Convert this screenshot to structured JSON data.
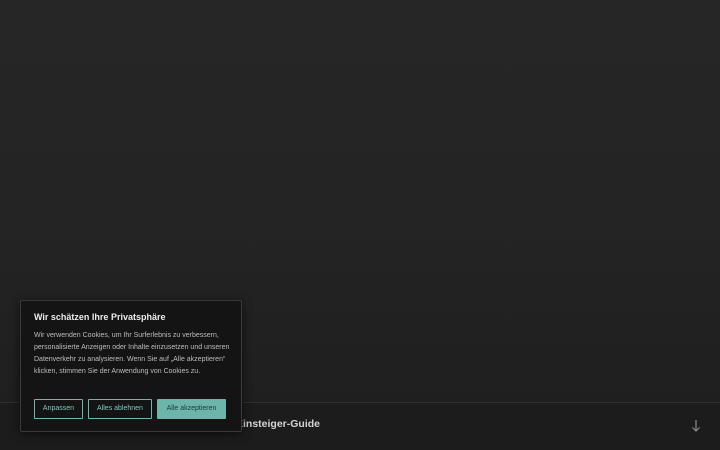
{
  "nav": {
    "title": "Einsteiger-Guide"
  },
  "cookie_banner": {
    "title": "Wir schätzen Ihre Privatsphäre",
    "text": "Wir verwenden Cookies, um Ihr Surferlebnis zu verbessern, personalisierte Anzeigen oder Inhalte einzusetzen und unseren Datenverkehr zu analysieren. Wenn Sie auf „Alle akzeptieren“ klicken, stimmen Sie der Anwendung von Cookies zu.",
    "buttons": {
      "customize": "Anpassen",
      "reject": "Alles ablehnen",
      "accept": "Alle akzeptieren"
    }
  },
  "icons": {
    "scroll_down": "arrow-down-icon"
  },
  "colors": {
    "accent": "#6bb5ab",
    "background": "#1e1e1e",
    "banner_bg": "#141414"
  }
}
